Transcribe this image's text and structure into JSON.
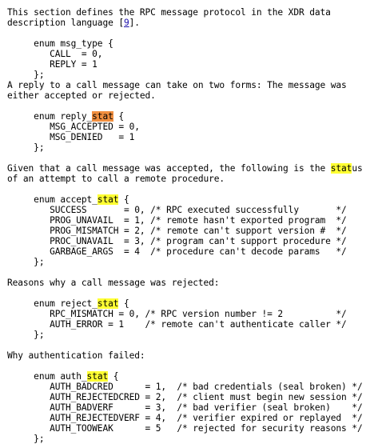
{
  "document": {
    "blocks": [
      {
        "type": "para",
        "lines": [
          [
            {
              "t": "This section defines the RPC message protocol in the XDR data"
            }
          ],
          [
            {
              "t": "description language ["
            },
            {
              "t": "9",
              "link": true
            },
            {
              "t": "]."
            }
          ]
        ]
      },
      {
        "type": "blank"
      },
      {
        "type": "code",
        "lines": [
          [
            {
              "t": "     enum msg_type {"
            }
          ],
          [
            {
              "t": "        CALL  = 0,"
            }
          ],
          [
            {
              "t": "        REPLY = 1"
            }
          ],
          [
            {
              "t": "     };"
            }
          ]
        ]
      },
      {
        "type": "para",
        "lines": [
          [
            {
              "t": "A reply to a call message can take on two forms: The message was"
            }
          ],
          [
            {
              "t": "either accepted or rejected."
            }
          ]
        ]
      },
      {
        "type": "blank"
      },
      {
        "type": "code",
        "lines": [
          [
            {
              "t": "     enum reply_"
            },
            {
              "t": "stat",
              "hl": "current"
            },
            {
              "t": " {"
            }
          ],
          [
            {
              "t": "        MSG_ACCEPTED = 0,"
            }
          ],
          [
            {
              "t": "        MSG_DENIED   = 1"
            }
          ],
          [
            {
              "t": "     };"
            }
          ]
        ]
      },
      {
        "type": "blank"
      },
      {
        "type": "para",
        "lines": [
          [
            {
              "t": "Given that a call message was accepted, the following is the "
            },
            {
              "t": "stat",
              "hl": "match"
            },
            {
              "t": "us"
            }
          ],
          [
            {
              "t": "of an attempt to call a remote procedure."
            }
          ]
        ]
      },
      {
        "type": "blank"
      },
      {
        "type": "code",
        "lines": [
          [
            {
              "t": "     enum accept_"
            },
            {
              "t": "stat",
              "hl": "match"
            },
            {
              "t": " {"
            }
          ],
          [
            {
              "t": "        SUCCESS       = 0, /* RPC executed successfully       */"
            }
          ],
          [
            {
              "t": "        PROG_UNAVAIL  = 1, /* remote hasn't exported program  */"
            }
          ],
          [
            {
              "t": "        PROG_MISMATCH = 2, /* remote can't support version #  */"
            }
          ],
          [
            {
              "t": "        PROC_UNAVAIL  = 3, /* program can't support procedure */"
            }
          ],
          [
            {
              "t": "        GARBAGE_ARGS  = 4  /* procedure can't decode params   */"
            }
          ],
          [
            {
              "t": "     };"
            }
          ]
        ]
      },
      {
        "type": "blank"
      },
      {
        "type": "para",
        "lines": [
          [
            {
              "t": "Reasons why a call message was rejected:"
            }
          ]
        ]
      },
      {
        "type": "blank"
      },
      {
        "type": "code",
        "lines": [
          [
            {
              "t": "     enum reject_"
            },
            {
              "t": "stat",
              "hl": "match"
            },
            {
              "t": " {"
            }
          ],
          [
            {
              "t": "        RPC_MISMATCH = 0, /* RPC version number != 2          */"
            }
          ],
          [
            {
              "t": "        AUTH_ERROR = 1    /* remote can't authenticate caller */"
            }
          ],
          [
            {
              "t": "     };"
            }
          ]
        ]
      },
      {
        "type": "blank"
      },
      {
        "type": "para",
        "lines": [
          [
            {
              "t": "Why authentication failed:"
            }
          ]
        ]
      },
      {
        "type": "blank"
      },
      {
        "type": "code",
        "lines": [
          [
            {
              "t": "     enum auth_"
            },
            {
              "t": "stat",
              "hl": "match"
            },
            {
              "t": " {"
            }
          ],
          [
            {
              "t": "        AUTH_BADCRED      = 1,  /* bad credentials (seal broken) */"
            }
          ],
          [
            {
              "t": "        AUTH_REJECTEDCRED = 2,  /* client must begin new session */"
            }
          ],
          [
            {
              "t": "        AUTH_BADVERF      = 3,  /* bad verifier (seal broken)    */"
            }
          ],
          [
            {
              "t": "        AUTH_REJECTEDVERF = 4,  /* verifier expired or replayed  */"
            }
          ],
          [
            {
              "t": "        AUTH_TOOWEAK      = 5   /* rejected for security reasons */"
            }
          ],
          [
            {
              "t": "     };"
            }
          ]
        ]
      }
    ]
  },
  "colors": {
    "current_match_highlight": "#f28f3f",
    "match_highlight": "#ffff33",
    "link": "#1a0dab"
  }
}
